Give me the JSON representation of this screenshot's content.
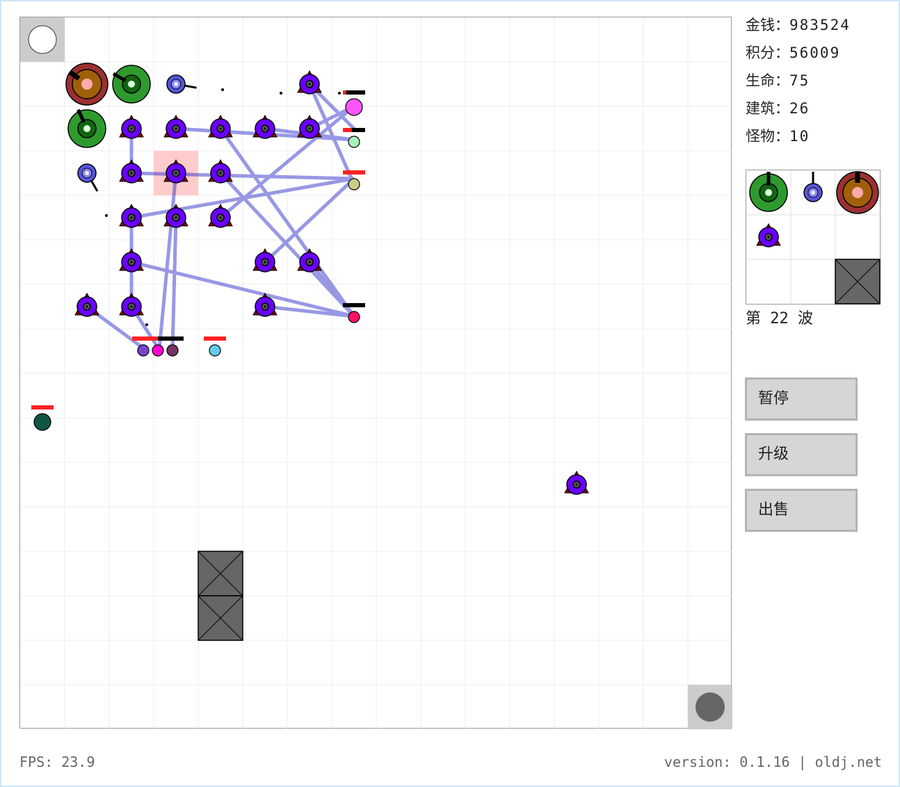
{
  "stats": [
    {
      "key": "money",
      "label": "金钱：",
      "value": "983524"
    },
    {
      "key": "score",
      "label": "积分：",
      "value": "56009"
    },
    {
      "key": "life",
      "label": "生命：",
      "value": "75"
    },
    {
      "key": "buildings",
      "label": "建筑：",
      "value": "26"
    },
    {
      "key": "monsters",
      "label": "怪物：",
      "value": "10"
    }
  ],
  "wave": {
    "prefix": "第",
    "number": "22",
    "suffix": "波"
  },
  "buttons": {
    "pause": "暂停",
    "upgrade": "升级",
    "sell": "出售"
  },
  "footer": {
    "fps": "FPS: 23.9",
    "version": "version: 0.1.16 | oldj.net"
  },
  "colors": {
    "laser_tower": "#6a00ff",
    "laser_beam": "#3333cc",
    "cannon_tower": "#2e9a2e",
    "heavy_tower": "#9b3030",
    "basic_tower": "#5555dd",
    "wall": "#666666",
    "selection": "#ffcccc",
    "grid": "#eeeeee"
  },
  "palette_items": [
    "cannon-tower-icon",
    "basic-tower-icon",
    "heavy-tower-icon",
    "laser-tower-icon",
    "wall-icon"
  ]
}
